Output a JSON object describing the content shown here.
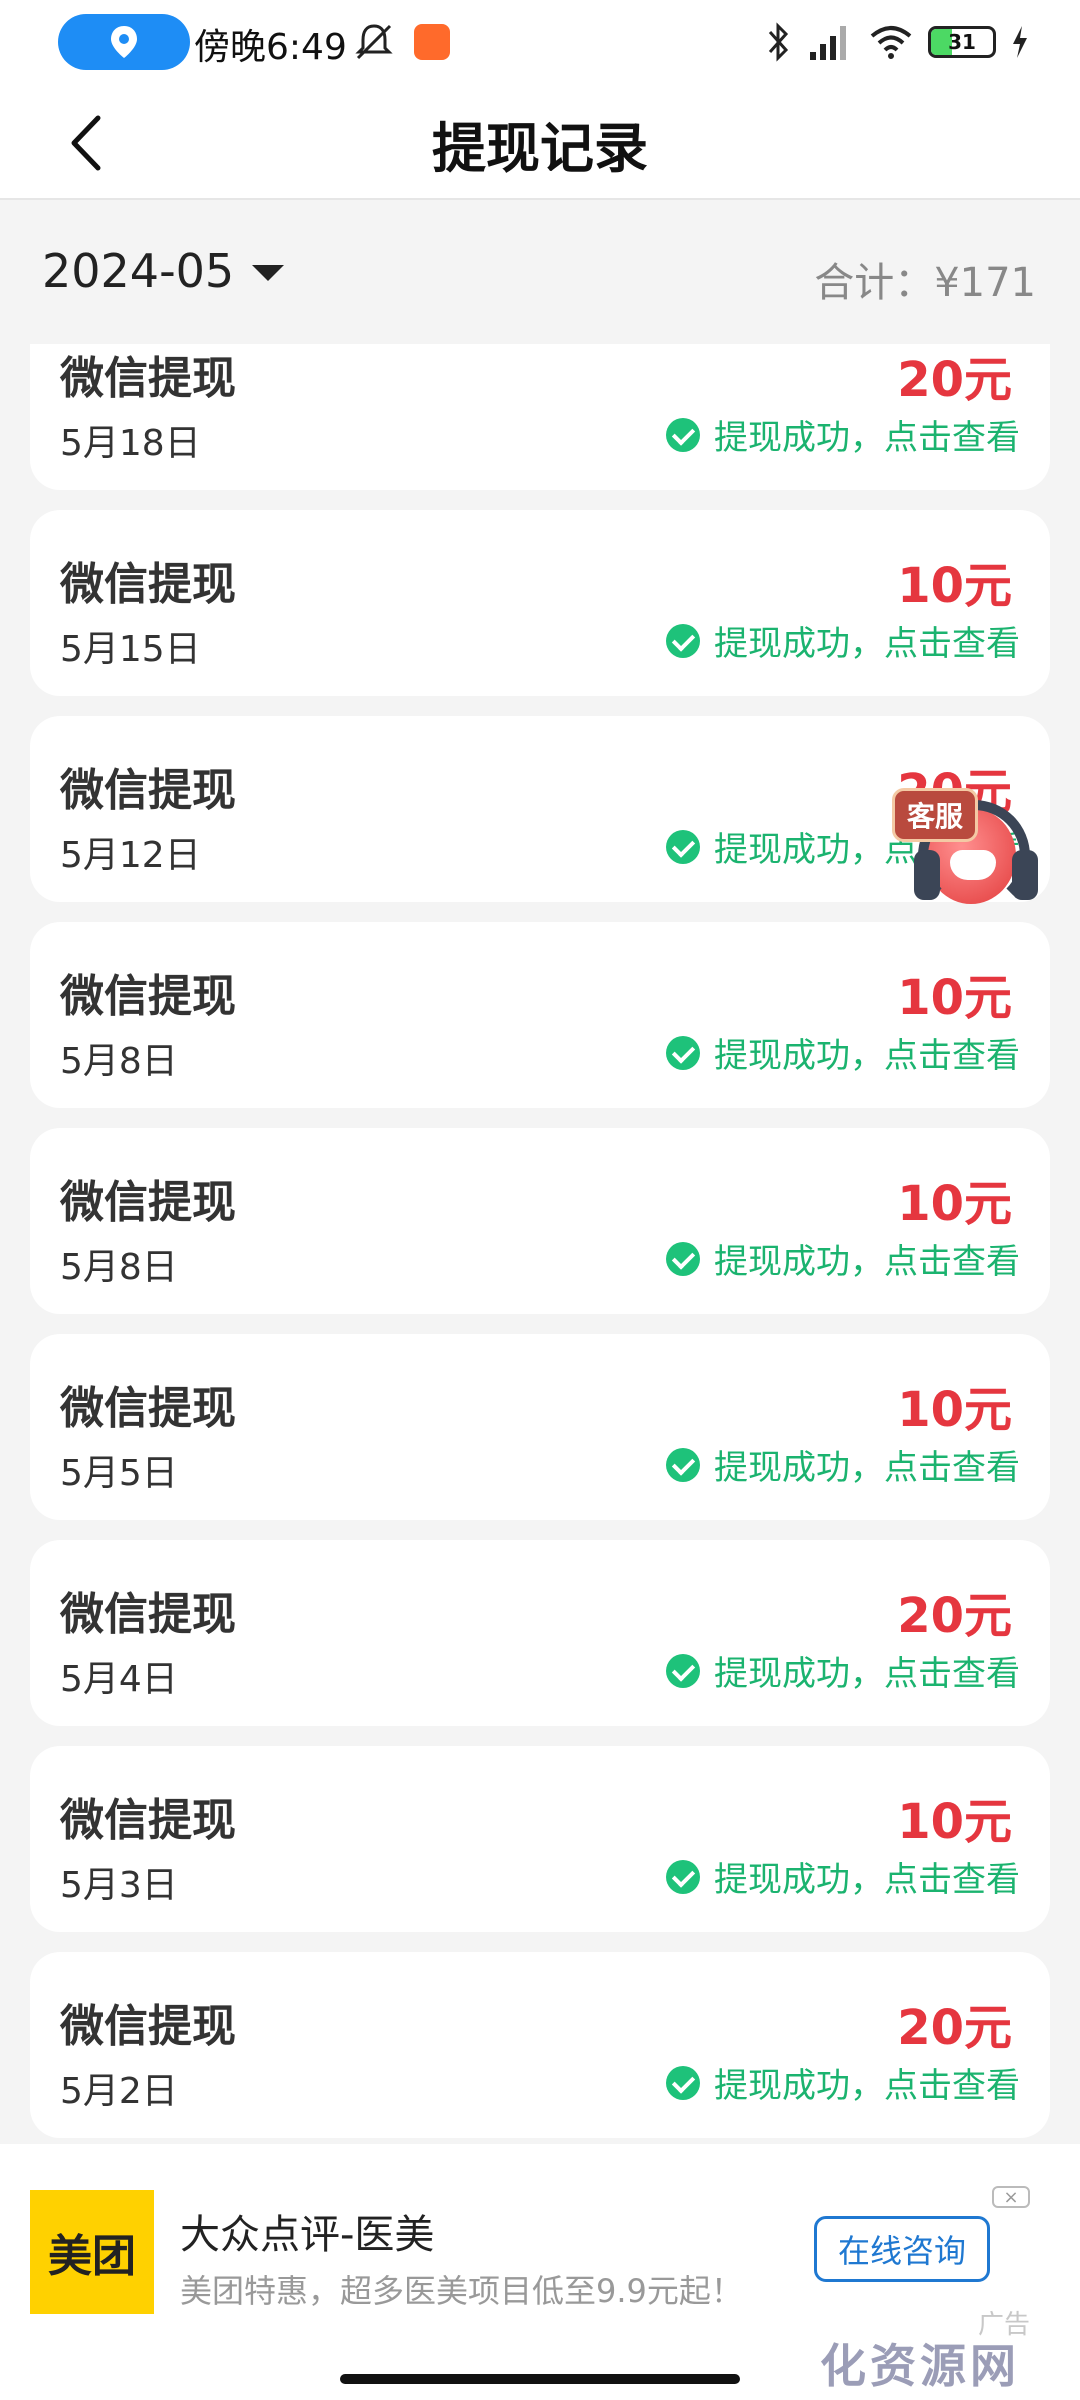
{
  "status_bar": {
    "time": "傍晚6:49",
    "battery": "31"
  },
  "header": {
    "title": "提现记录"
  },
  "filter": {
    "month": "2024-05",
    "total": "合计：¥171"
  },
  "records": [
    {
      "title": "微信提现",
      "date": "5月18日",
      "amount": "20元",
      "status": "提现成功，点击查看"
    },
    {
      "title": "微信提现",
      "date": "5月15日",
      "amount": "10元",
      "status": "提现成功，点击查看"
    },
    {
      "title": "微信提现",
      "date": "5月12日",
      "amount": "20元",
      "status": "提现成功，点击查看"
    },
    {
      "title": "微信提现",
      "date": "5月8日",
      "amount": "10元",
      "status": "提现成功，点击查看"
    },
    {
      "title": "微信提现",
      "date": "5月8日",
      "amount": "10元",
      "status": "提现成功，点击查看"
    },
    {
      "title": "微信提现",
      "date": "5月5日",
      "amount": "10元",
      "status": "提现成功，点击查看"
    },
    {
      "title": "微信提现",
      "date": "5月4日",
      "amount": "20元",
      "status": "提现成功，点击查看"
    },
    {
      "title": "微信提现",
      "date": "5月3日",
      "amount": "10元",
      "status": "提现成功，点击查看"
    },
    {
      "title": "微信提现",
      "date": "5月2日",
      "amount": "20元",
      "status": "提现成功，点击查看"
    }
  ],
  "service": {
    "label": "客服"
  },
  "ad": {
    "logo": "美团",
    "title": "大众点评-医美",
    "subtitle": "美团特惠，超多医美项目低至9.9元起！",
    "button": "在线咨询",
    "close": "×",
    "label": "广告"
  },
  "watermark": "化资源网",
  "colors": {
    "amount": "#e5363f",
    "success": "#1bb36f",
    "accent": "#1f78d1"
  }
}
